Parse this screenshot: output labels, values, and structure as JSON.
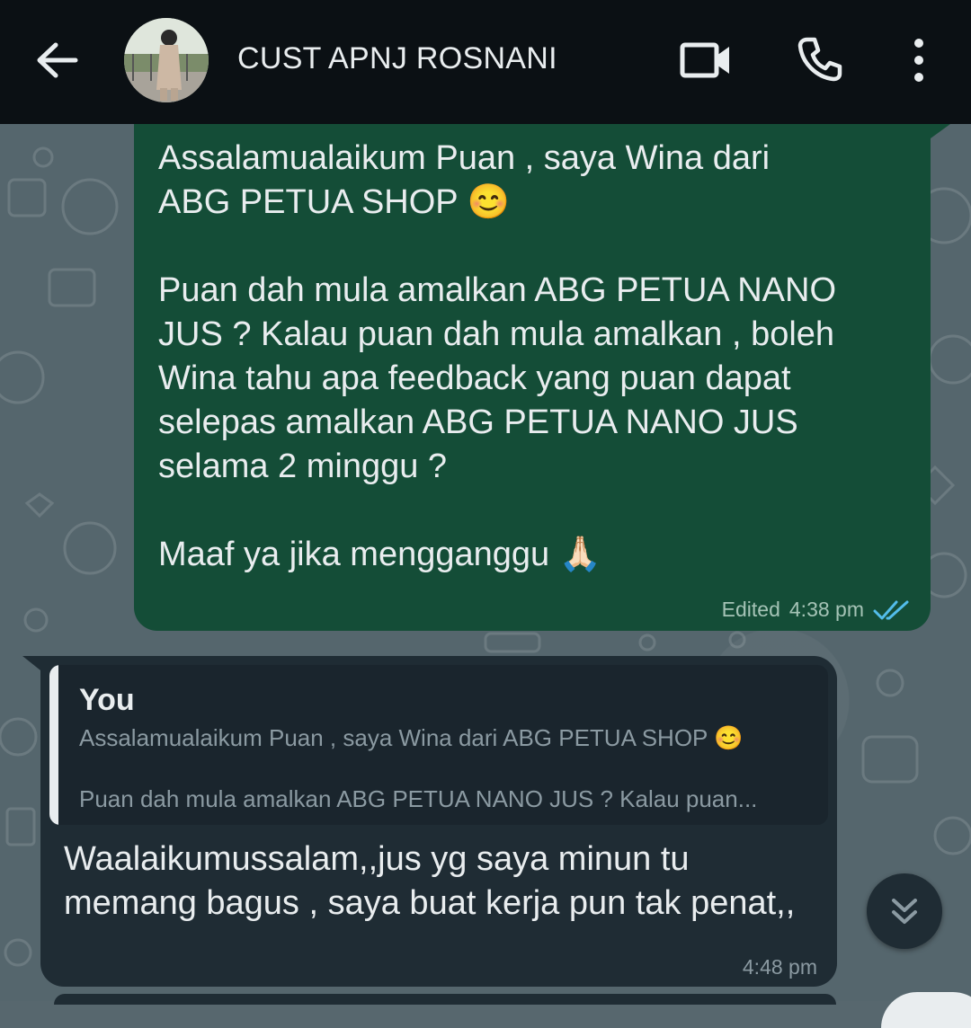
{
  "header": {
    "contact_name": "CUST APNJ ROSNANI",
    "back_icon": "arrow-left-icon",
    "video_icon": "video-call-icon",
    "call_icon": "phone-icon",
    "menu_icon": "more-vertical-icon"
  },
  "messages": {
    "outgoing": {
      "text": "Assalamualaikum Puan , saya Wina dari\nABG PETUA SHOP 😊\n\nPuan dah mula amalkan ABG PETUA NANO\nJUS ? Kalau puan dah mula amalkan , boleh\nWina tahu apa feedback yang puan dapat\nselepas amalkan ABG PETUA NANO JUS\nselama 2 minggu ?\n\nMaaf ya jika mengganggu 🙏🏻",
      "edited_label": "Edited",
      "time": "4:38 pm",
      "status_icon": "double-check-icon",
      "status_color": "#53bdeb"
    },
    "incoming": {
      "quote_author": "You",
      "quote_line1": "Assalamualaikum Puan , saya Wina dari ABG PETUA SHOP 😊",
      "quote_line2": "Puan dah mula amalkan ABG PETUA NANO JUS ? Kalau puan...",
      "text": "Waalaikumussalam,,jus yg saya minun tu memang bagus , saya buat kerja pun tak penat,,",
      "time": "4:48 pm"
    }
  },
  "scroll_button": {
    "icon": "double-chevron-down-icon"
  },
  "colors": {
    "header_bg": "#0b1014",
    "outgoing_bubble": "#144d37",
    "incoming_bubble": "#1f2c34",
    "wallpaper": "#55666d"
  }
}
